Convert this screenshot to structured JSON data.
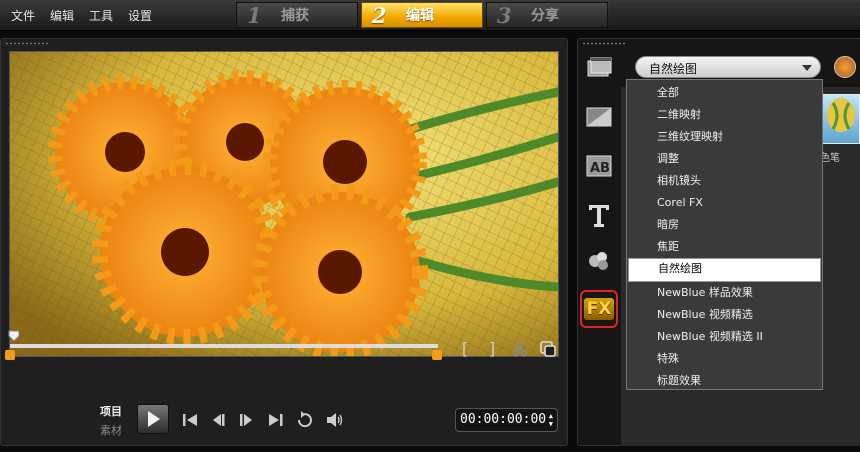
{
  "menu": [
    "文件",
    "编辑",
    "工具",
    "设置"
  ],
  "steps": [
    {
      "num": "1",
      "label": "捕获",
      "active": false
    },
    {
      "num": "2",
      "label": "编辑",
      "active": true
    },
    {
      "num": "3",
      "label": "分享",
      "active": false
    }
  ],
  "player": {
    "mode_project": "项目",
    "mode_clip": "素材",
    "timecode": "00:00:00:00",
    "mark_in": "[",
    "mark_out": "]"
  },
  "library": {
    "category_selected": "自然绘图",
    "categories": [
      "全部",
      "二维映射",
      "三维纹理映射",
      "调整",
      "相机镜头",
      "Corel FX",
      "暗房",
      "焦距",
      "自然绘图",
      "NewBlue 样品效果",
      "NewBlue 视频精选",
      "NewBlue 视频精选 II",
      "特殊",
      "标题效果"
    ],
    "thumbnail_label": "色笔",
    "fx_label": "FX"
  },
  "colors": {
    "accent_active_step": "#f0a800",
    "highlight_border": "#e32222",
    "trim_handle": "#f49b1b"
  }
}
